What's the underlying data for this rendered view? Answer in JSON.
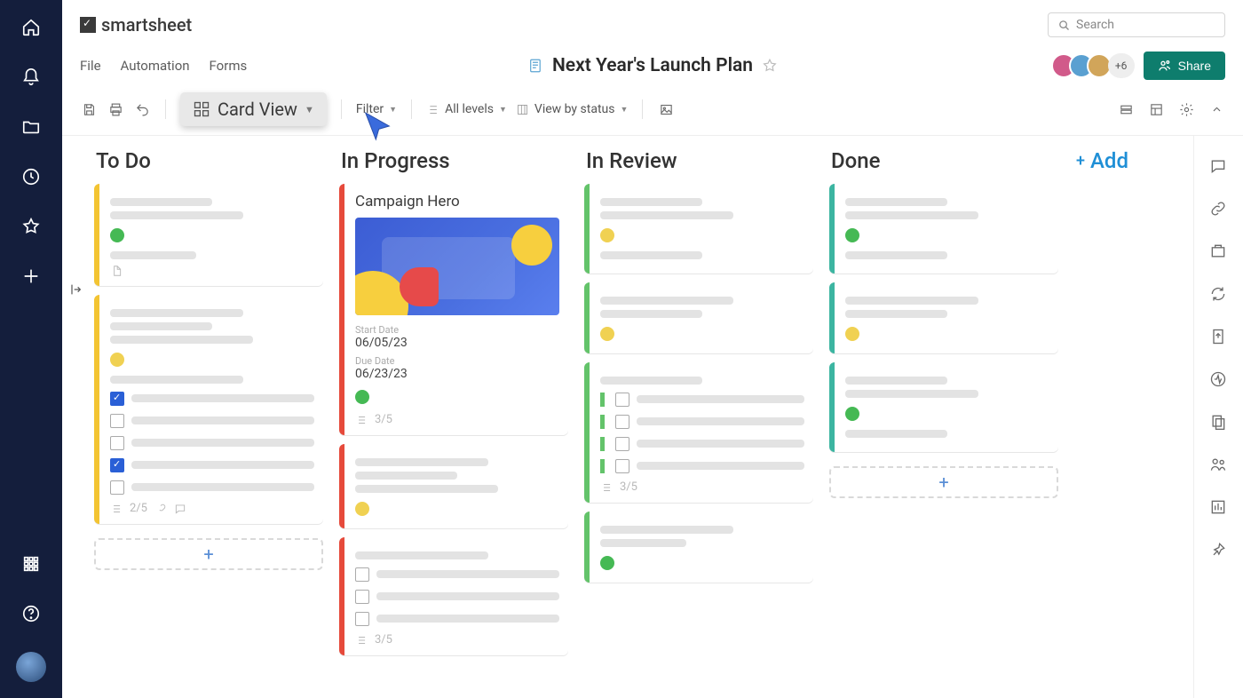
{
  "brand": "smartsheet",
  "search_placeholder": "Search",
  "menus": {
    "file": "File",
    "automation": "Automation",
    "forms": "Forms"
  },
  "sheet": {
    "title": "Next Year's Launch Plan"
  },
  "collab": {
    "more": "+6",
    "share": "Share"
  },
  "toolbar": {
    "view_label": "Card View",
    "filter": "Filter",
    "levels": "All levels",
    "view_by": "View by status"
  },
  "board": {
    "columns": [
      {
        "name": "To Do"
      },
      {
        "name": "In Progress"
      },
      {
        "name": "In Review"
      },
      {
        "name": "Done"
      }
    ],
    "add_label": "Add"
  },
  "hero": {
    "title": "Campaign Hero",
    "start_label": "Start Date",
    "start_val": "06/05/23",
    "due_label": "Due Date",
    "due_val": "06/23/23"
  },
  "progress": {
    "three_five": "3/5",
    "two_five": "2/5"
  },
  "avatars": {
    "c1": "#d15a8a",
    "c2": "#5aa0d1",
    "c3": "#d1a55a"
  }
}
